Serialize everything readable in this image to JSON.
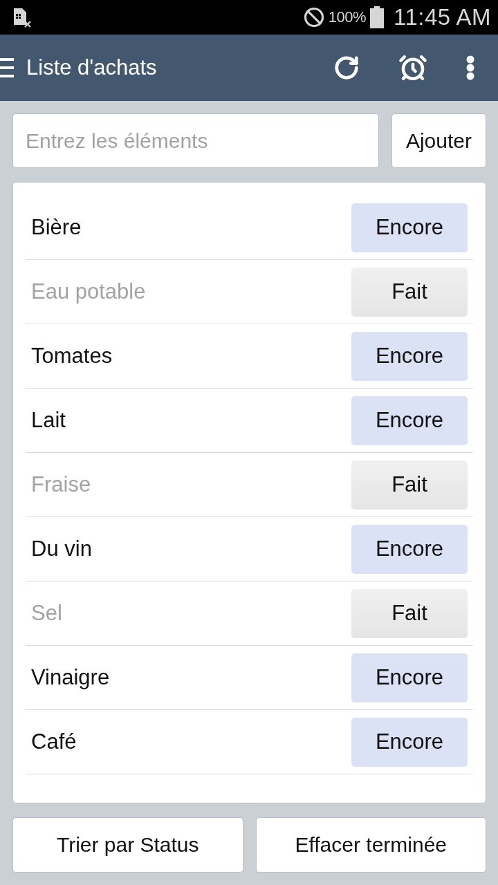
{
  "status_bar": {
    "battery": "100%",
    "time": "11:45 AM"
  },
  "app_bar": {
    "title": "Liste d'achats"
  },
  "add_form": {
    "placeholder": "Entrez les éléments",
    "button": "Ajouter"
  },
  "items": [
    {
      "name": "Bière",
      "done": false,
      "action": "Encore"
    },
    {
      "name": "Eau potable",
      "done": true,
      "action": "Fait"
    },
    {
      "name": "Tomates",
      "done": false,
      "action": "Encore"
    },
    {
      "name": "Lait",
      "done": false,
      "action": "Encore"
    },
    {
      "name": "Fraise",
      "done": true,
      "action": "Fait"
    },
    {
      "name": "Du vin",
      "done": false,
      "action": "Encore"
    },
    {
      "name": "Sel",
      "done": true,
      "action": "Fait"
    },
    {
      "name": "Vinaigre",
      "done": false,
      "action": "Encore"
    },
    {
      "name": "Café",
      "done": false,
      "action": "Encore"
    }
  ],
  "footer_buttons": [
    "Trier par Status",
    "Effacer terminée"
  ]
}
